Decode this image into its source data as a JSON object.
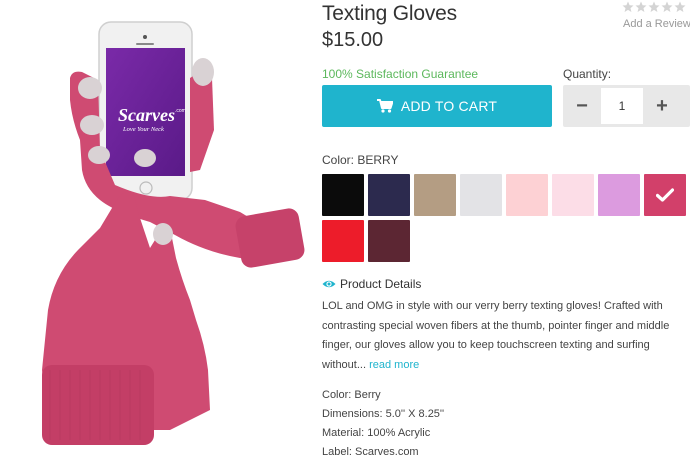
{
  "product": {
    "title": "Texting Gloves",
    "price": "$15.00",
    "guarantee": "100% Satisfaction Guarantee",
    "image_brand": "Scarves",
    "image_brand_suffix": ".com",
    "image_tagline": "Love Your Neck"
  },
  "review": {
    "stars_filled": 0,
    "stars_total": 5,
    "add_review_label": "Add a Review"
  },
  "cart": {
    "button_label": "ADD TO CART",
    "icon": "cart-icon",
    "quantity_label": "Quantity:",
    "quantity_value": "1",
    "minus_label": "−",
    "plus_label": "+"
  },
  "colors": {
    "label": "Color: BERRY",
    "selected": "Berry",
    "swatches": [
      {
        "name": "black",
        "hex": "#0b0b0b"
      },
      {
        "name": "navy",
        "hex": "#2c2a4e"
      },
      {
        "name": "taupe",
        "hex": "#b49d83"
      },
      {
        "name": "light-gray",
        "hex": "#e3e3e6"
      },
      {
        "name": "light-pink",
        "hex": "#fdd1d4"
      },
      {
        "name": "pale-pink",
        "hex": "#fcdde7"
      },
      {
        "name": "lavender",
        "hex": "#dc9bdf"
      },
      {
        "name": "berry",
        "hex": "#d2406a",
        "selected": true
      },
      {
        "name": "red",
        "hex": "#ed1c2a"
      },
      {
        "name": "burgundy",
        "hex": "#5c2633"
      }
    ]
  },
  "details": {
    "heading": "Product Details",
    "icon": "eye-icon",
    "description": "LOL and OMG in style with our verry berry texting gloves! Crafted with contrasting special woven fibers at the thumb, pointer finger and middle finger, our gloves allow you to keep touchscreen texting and surfing without...",
    "read_more": "read more",
    "specs": [
      "Color: Berry",
      "Dimensions: 5.0'' X 8.25''",
      "Material: 100% Acrylic",
      "Label: Scarves.com"
    ]
  },
  "theme": {
    "accent": "#1fb4cd",
    "guarantee_green": "#5cb85c",
    "glove_pink": "#cf4b72"
  }
}
